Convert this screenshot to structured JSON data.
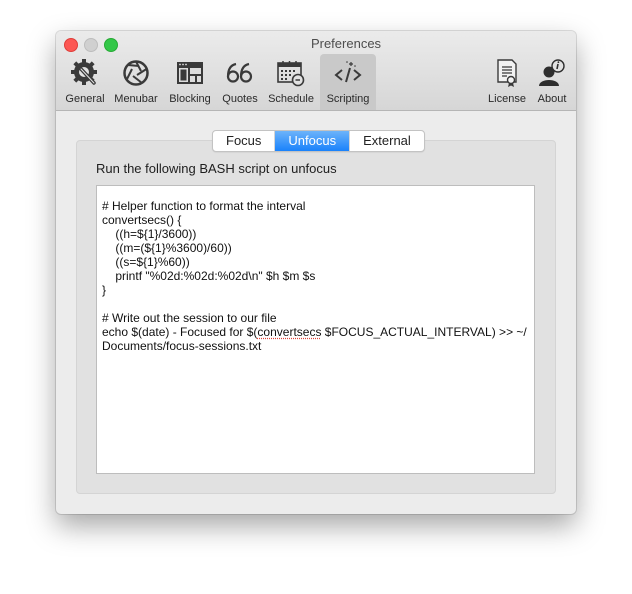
{
  "window": {
    "title": "Preferences"
  },
  "toolbar": {
    "items": [
      {
        "label": "General",
        "icon": "gear-wrench-icon"
      },
      {
        "label": "Menubar",
        "icon": "aperture-icon"
      },
      {
        "label": "Blocking",
        "icon": "browser-window-icon"
      },
      {
        "label": "Quotes",
        "icon": "quote-marks-icon"
      },
      {
        "label": "Schedule",
        "icon": "calendar-clock-icon"
      },
      {
        "label": "Scripting",
        "icon": "code-brackets-icon",
        "active": true
      },
      {
        "label": "License",
        "icon": "certificate-icon"
      },
      {
        "label": "About",
        "icon": "person-info-icon"
      }
    ]
  },
  "tabs": {
    "items": [
      {
        "label": "Focus"
      },
      {
        "label": "Unfocus",
        "selected": true
      },
      {
        "label": "External"
      }
    ]
  },
  "panel": {
    "description": "Run the following BASH script on unfocus",
    "script_lines": [
      "# Helper function to format the interval",
      "convertsecs() {",
      "    ((h=${1}/3600))",
      "    ((m=(${1}%3600)/60))",
      "    ((s=${1}%60))",
      "    printf \"%02d:%02d:%02d\\n\" $h $m $s",
      "}",
      "",
      "# Write out the session to our file",
      "echo $(date) - Focused for $(",
      "convertsecs",
      " $FOCUS_ACTUAL_INTERVAL) >> ~/",
      "Documents/focus-sessions.txt"
    ]
  }
}
